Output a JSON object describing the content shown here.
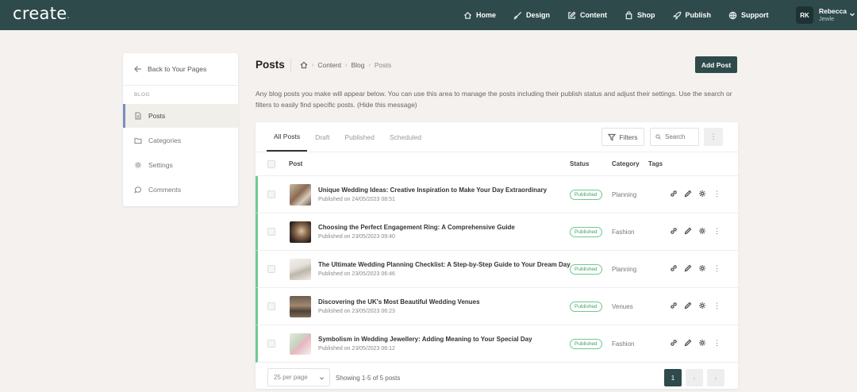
{
  "brand": {
    "logo": "create",
    "logo_dot": "."
  },
  "nav": {
    "items": [
      {
        "label": "Home",
        "icon": "home-icon"
      },
      {
        "label": "Design",
        "icon": "brush-icon"
      },
      {
        "label": "Content",
        "icon": "edit-icon"
      },
      {
        "label": "Shop",
        "icon": "bag-icon"
      },
      {
        "label": "Publish",
        "icon": "rocket-icon"
      },
      {
        "label": "Support",
        "icon": "globe-icon"
      }
    ],
    "user": {
      "initials": "RK",
      "first": "Rebecca",
      "last": "Jewle"
    }
  },
  "sidebar": {
    "back_label": "Back to Your Pages",
    "section": "BLOG",
    "items": [
      {
        "label": "Posts",
        "icon": "document-icon",
        "active": true
      },
      {
        "label": "Categories",
        "icon": "folder-icon",
        "active": false
      },
      {
        "label": "Settings",
        "icon": "gear-icon",
        "active": false
      },
      {
        "label": "Comments",
        "icon": "comment-icon",
        "active": false
      }
    ]
  },
  "header": {
    "title": "Posts",
    "breadcrumb": [
      "Content",
      "Blog",
      "Posts"
    ],
    "add_button": "Add Post"
  },
  "intro": {
    "text": "Any blog posts you make will appear below. You can use this area to manage the posts including their publish status and adjust their settings. Use the search or filters to easily find specific posts.",
    "hide_link": "(Hide this message)"
  },
  "toolbar": {
    "tabs": [
      "All Posts",
      "Draft",
      "Published",
      "Scheduled"
    ],
    "active_tab": "All Posts",
    "filters_label": "Filters",
    "search_placeholder": "Search",
    "more_label": "⋮"
  },
  "table": {
    "columns": {
      "post": "Post",
      "status": "Status",
      "category": "Category",
      "tags": "Tags"
    },
    "rows": [
      {
        "title": "Unique Wedding Ideas: Creative Inspiration to Make Your Day Extraordinary",
        "date": "Published on 24/05/2023 08:51",
        "status": "Published",
        "category": "Planning"
      },
      {
        "title": "Choosing the Perfect Engagement Ring: A Comprehensive Guide",
        "date": "Published on 23/05/2023 09:40",
        "status": "Published",
        "category": "Fashion"
      },
      {
        "title": "The Ultimate Wedding Planning Checklist: A Step-by-Step Guide to Your Dream Day",
        "date": "Published on 23/05/2023 06:46",
        "status": "Published",
        "category": "Planning"
      },
      {
        "title": "Discovering the UK's Most Beautiful Wedding Venues",
        "date": "Published on 23/05/2023 06:23",
        "status": "Published",
        "category": "Venues"
      },
      {
        "title": "Symbolism in Wedding Jewellery: Adding Meaning to Your Special Day",
        "date": "Published on 23/05/2023 06:12",
        "status": "Published",
        "category": "Fashion"
      }
    ]
  },
  "footer": {
    "per_page": "25 per page",
    "showing": "Showing 1-5 of 5 posts",
    "current_page": "1",
    "prev": "‹",
    "next": "›"
  },
  "colors": {
    "topbar": "#2f4a4b",
    "accent": "#2f4a4b",
    "published": "#6ccb8f",
    "active_border": "#7a8dc2"
  }
}
